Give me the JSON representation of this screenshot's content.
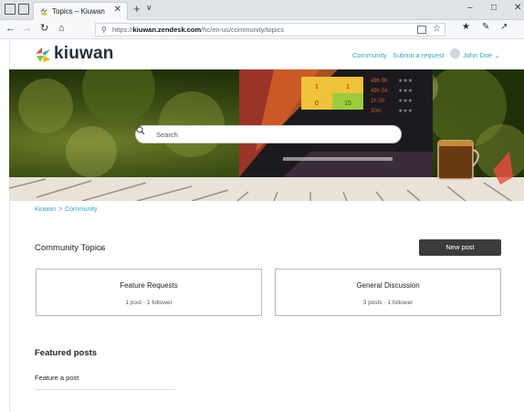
{
  "browser": {
    "tab_title": "Topics – Kiuwan",
    "tab_close": "✕",
    "new_tab": "+",
    "tab_menu": "∨",
    "url_prefix": "https://",
    "url_host": "kiuwan.zendesk.com",
    "url_path": "/hc/en-us/community/topics",
    "window_controls": {
      "minimize": "–",
      "maximize": "□",
      "close": "✕"
    },
    "icons": [
      "back-arrow-icon",
      "forward-arrow-icon",
      "refresh-icon",
      "home-icon",
      "lock-icon",
      "reading-view-icon",
      "favorite-star-icon",
      "favorites-icon",
      "pen-icon",
      "share-icon"
    ]
  },
  "site": {
    "logo_text": "kiuwan",
    "nav": {
      "community": "Community",
      "submit_request": "Submit a request"
    },
    "user": {
      "name": "John Doe",
      "caret": "⌄"
    },
    "brand_colors": {
      "link": "#2ea3c7",
      "dark": "#23303b",
      "button": "#3c3c3c"
    }
  },
  "hero": {
    "search_placeholder": "Search",
    "screen_widgets": [
      "1",
      "1",
      "0",
      "15"
    ],
    "screen_times": [
      "49h 36",
      "49h 34",
      "1h 00",
      "30m"
    ]
  },
  "breadcrumb": {
    "items": [
      "Kiuwan",
      "Community"
    ],
    "separator": ">"
  },
  "topics": {
    "title": "Community Topics",
    "caret": "⌄",
    "new_post": "New post",
    "cards": [
      {
        "title": "Feature Requests",
        "meta": "1 post · 1 follower"
      },
      {
        "title": "General Discussion",
        "meta": "3 posts · 1 follower"
      }
    ]
  },
  "featured": {
    "title": "Featured posts",
    "items": [
      "Feature a post"
    ]
  }
}
